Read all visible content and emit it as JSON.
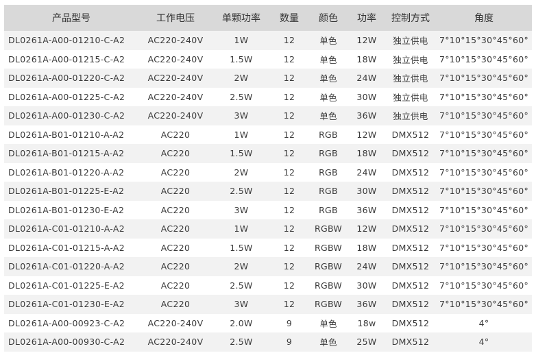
{
  "table": {
    "columns": [
      "产品型号",
      "工作电压",
      "单颗功率",
      "数量",
      "颜色",
      "功率",
      "控制方式",
      "角度"
    ],
    "rows": [
      [
        "DL0261A-A00-01210-C-A2",
        "AC220-240V",
        "1W",
        "12",
        "单色",
        "12W",
        "独立供电",
        "7°10°15°30°45°60°"
      ],
      [
        "DL0261A-A00-01215-C-A2",
        "AC220-240V",
        "1.5W",
        "12",
        "单色",
        "18W",
        "独立供电",
        "7°10°15°30°45°60°"
      ],
      [
        "DL0261A-A00-01220-C-A2",
        "AC220-240V",
        "2W",
        "12",
        "单色",
        "24W",
        "独立供电",
        "7°10°15°30°45°60°"
      ],
      [
        "DL0261A-A00-01225-C-A2",
        "AC220-240V",
        "2.5W",
        "12",
        "单色",
        "30W",
        "独立供电",
        "7°10°15°30°45°60°"
      ],
      [
        "DL0261A-A00-01230-C-A2",
        "AC220-240V",
        "3W",
        "12",
        "单色",
        "36W",
        "独立供电",
        "7°10°15°30°45°60°"
      ],
      [
        "DL0261A-B01-01210-A-A2",
        "AC220",
        "1W",
        "12",
        "RGB",
        "12W",
        "DMX512",
        "7°10°15°30°45°60°"
      ],
      [
        "DL0261A-B01-01215-A-A2",
        "AC220",
        "1.5W",
        "12",
        "RGB",
        "18W",
        "DMX512",
        "7°10°15°30°45°60°"
      ],
      [
        "DL0261A-B01-01220-A-A2",
        "AC220",
        "2W",
        "12",
        "RGB",
        "24W",
        "DMX512",
        "7°10°15°30°45°60°"
      ],
      [
        "DL0261A-B01-01225-E-A2",
        "AC220",
        "2.5W",
        "12",
        "RGB",
        "30W",
        "DMX512",
        "7°10°15°30°45°60°"
      ],
      [
        "DL0261A-B01-01230-E-A2",
        "AC220",
        "3W",
        "12",
        "RGB",
        "36W",
        "DMX512",
        "7°10°15°30°45°60°"
      ],
      [
        "DL0261A-C01-01210-A-A2",
        "AC220",
        "1W",
        "12",
        "RGBW",
        "12W",
        "DMX512",
        "7°10°15°30°45°60°"
      ],
      [
        "DL0261A-C01-01215-A-A2",
        "AC220",
        "1.5W",
        "12",
        "RGBW",
        "18W",
        "DMX512",
        "7°10°15°30°45°60°"
      ],
      [
        "DL0261A-C01-01220-A-A2",
        "AC220",
        "2W",
        "12",
        "RGBW",
        "24W",
        "DMX512",
        "7°10°15°30°45°60°"
      ],
      [
        "DL0261A-C01-01225-E-A2",
        "AC220",
        "2.5W",
        "12",
        "RGBW",
        "30W",
        "DMX512",
        "7°10°15°30°45°60°"
      ],
      [
        "DL0261A-C01-01230-E-A2",
        "AC220",
        "3W",
        "12",
        "RGBW",
        "36W",
        "DMX512",
        "7°10°15°30°45°60°"
      ],
      [
        "DL0261A-A00-00923-C-A2",
        "AC220-240V",
        "2.0W",
        "9",
        "单色",
        "18w",
        "DMX512",
        "4°"
      ],
      [
        "DL0261A-A00-00930-C-A2",
        "AC220-240V",
        "2.5W",
        "9",
        "单色",
        "25W",
        "DMX512",
        "4°"
      ]
    ]
  }
}
